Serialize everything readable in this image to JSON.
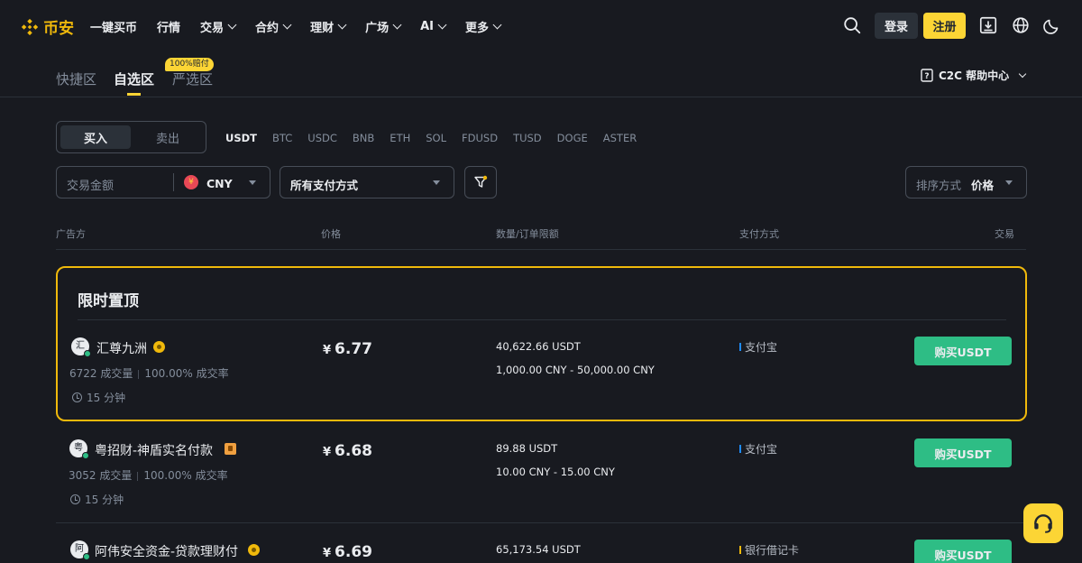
{
  "brand": {
    "name": "币安"
  },
  "nav": {
    "items": [
      {
        "label": "一键买币",
        "dropdown": false
      },
      {
        "label": "行情",
        "dropdown": false
      },
      {
        "label": "交易",
        "dropdown": true
      },
      {
        "label": "合约",
        "dropdown": true
      },
      {
        "label": "理财",
        "dropdown": true
      },
      {
        "label": "广场",
        "dropdown": true
      },
      {
        "label": "AI",
        "dropdown": true
      },
      {
        "label": "更多",
        "dropdown": true
      }
    ],
    "login": "登录",
    "register": "注册"
  },
  "subtabs": {
    "items": [
      "快捷区",
      "自选区",
      "严选区"
    ],
    "active": "自选区",
    "promo_badge": "100%赔付",
    "help": "C2C 帮助中心"
  },
  "trade_toggle": {
    "buy": "买入",
    "sell": "卖出",
    "active": "买入"
  },
  "coins": [
    "USDT",
    "BTC",
    "USDC",
    "BNB",
    "ETH",
    "SOL",
    "FDUSD",
    "TUSD",
    "DOGE",
    "ASTER"
  ],
  "active_coin": "USDT",
  "filters": {
    "amount_placeholder": "交易金额",
    "currency": "CNY",
    "currency_symbol": "¥",
    "payment": "所有支付方式",
    "sort_label": "排序方式",
    "sort_value": "价格"
  },
  "table_headers": {
    "advertiser": "广告方",
    "price": "价格",
    "amount_limit": "数量/订单限额",
    "payment": "支付方式",
    "trade": "交易"
  },
  "featured": {
    "title": "限时置顶"
  },
  "listings": [
    {
      "avatar": "汇",
      "name": "汇尊九洲",
      "badge": "gold",
      "volume": "6722 成交量",
      "completion": "100.00% 成交率",
      "time": "15 分钟",
      "currency_symbol": "¥",
      "price": "6.77",
      "quantity": "40,622.66 USDT",
      "limit": "1,000.00 CNY - 50,000.00 CNY",
      "payment": "支付宝",
      "payment_color": "#1e8bfa",
      "action": "购买USDT"
    },
    {
      "avatar": "粤",
      "name": "粤招财-神盾实名付款",
      "badge": "orange",
      "volume": "3052 成交量",
      "completion": "100.00% 成交率",
      "time": "15 分钟",
      "currency_symbol": "¥",
      "price": "6.68",
      "quantity": "89.88 USDT",
      "limit": "10.00 CNY - 15.00 CNY",
      "payment": "支付宝",
      "payment_color": "#1e8bfa",
      "action": "购买USDT"
    },
    {
      "avatar": "阿",
      "name": "阿伟安全资金-贷款理财付",
      "badge": "gold",
      "currency_symbol": "¥",
      "price": "6.69",
      "quantity": "65,173.54 USDT",
      "payment": "银行借记卡",
      "payment_color": "#f0b90b",
      "action": "购买USDT"
    }
  ],
  "colors": {
    "background": "#181a20",
    "accent": "#fcd535",
    "brand": "#f0b90b",
    "buy": "#2ebd85"
  }
}
